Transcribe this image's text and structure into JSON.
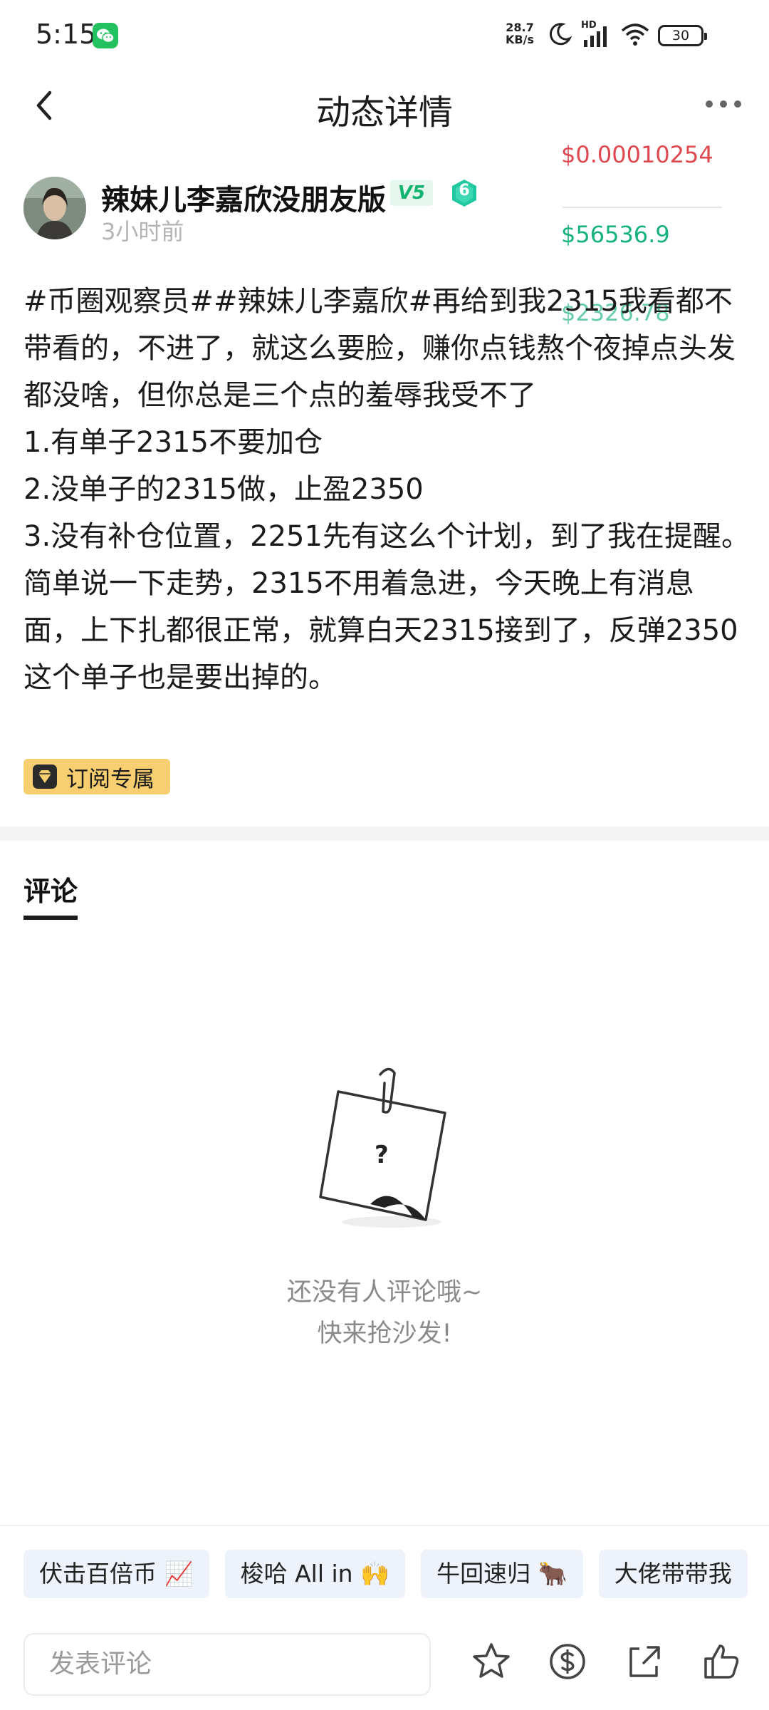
{
  "status_bar": {
    "time": "5:15",
    "net_speed_value": "28.7",
    "net_speed_unit": "KB/s",
    "network_label": "HD",
    "battery": "30"
  },
  "header": {
    "title": "动态详情"
  },
  "author": {
    "name": "辣妹儿李嘉欣没朋友版",
    "vip": "V5",
    "level": "6",
    "time": "3小时前"
  },
  "ticker": {
    "price_red": "$0.00010254",
    "price_green": "$56536.9",
    "price_green_2": "$2326.78"
  },
  "post": {
    "lines": [
      "#币圈观察员##辣妹儿李嘉欣#再给到我2315我看都不带看的，不进了，就这么要脸，赚你点钱熬个夜掉点头发都没啥，但你总是三个点的羞辱我受不了",
      "1.有单子2315不要加仓",
      "2.没单子的2315做，止盈2350",
      "3.没有补仓位置，2251先有这么个计划，到了我在提醒。",
      "简单说一下走势，2315不用着急进，今天晚上有消息面，上下扎都很正常，就算白天2315接到了，反弹2350这个单子也是要出掉的。"
    ],
    "tag": "订阅专属"
  },
  "comments": {
    "tab_label": "评论",
    "empty_line1": "还没有人评论哦~",
    "empty_line2": "快来抢沙发!"
  },
  "quick_replies": [
    "伏击百倍币 📈",
    "梭哈 All in 🙌",
    "牛回速归 🐂",
    "大佬带带我"
  ],
  "bottom_bar": {
    "input_placeholder": "发表评论"
  },
  "colors": {
    "red": "#e0484f",
    "green": "#15b27d",
    "tag_bg": "#f7cf71",
    "chip_bg": "#eef3fb"
  }
}
